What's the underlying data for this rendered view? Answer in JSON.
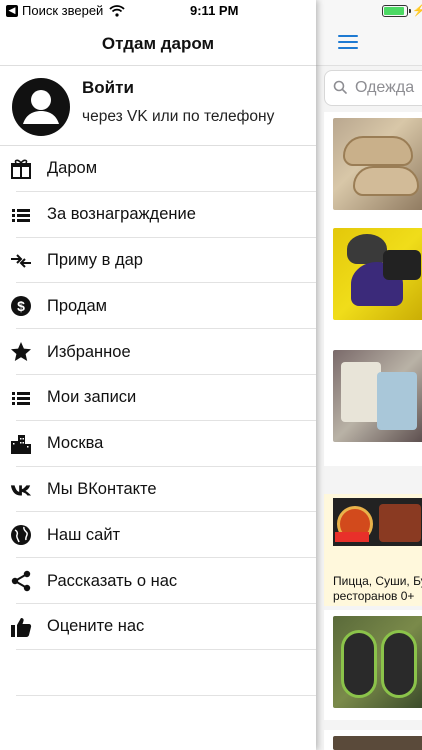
{
  "status_bar": {
    "back_app": "Поиск зверей",
    "time": "9:11 PM",
    "battery_level": 0.9
  },
  "drawer": {
    "title": "Отдам даром",
    "login": {
      "title": "Войти",
      "subtitle": "через VK или по телефону"
    },
    "menu": [
      {
        "label": "Даром",
        "icon": "gift-icon"
      },
      {
        "label": "За вознаграждение",
        "icon": "list-icon"
      },
      {
        "label": "Приму в дар",
        "icon": "swap-arrows-icon"
      },
      {
        "label": "Продам",
        "icon": "dollar-icon"
      },
      {
        "label": "Избранное",
        "icon": "star-icon"
      },
      {
        "label": "Мои записи",
        "icon": "list-icon"
      },
      {
        "label": "Москва",
        "icon": "city-icon"
      },
      {
        "label": "Мы ВКонтакте",
        "icon": "vk-icon"
      },
      {
        "label": "Наш сайт",
        "icon": "globe-icon"
      },
      {
        "label": "Рассказать о нас",
        "icon": "share-icon"
      },
      {
        "label": "Оцените нас",
        "icon": "thumbs-up-icon"
      }
    ]
  },
  "background_page": {
    "search_placeholder": "Одежда",
    "ad": {
      "text_line1": "Пицца, Суши, Бу",
      "text_line2": "ресторанов 0+"
    },
    "colors": {
      "accent": "#1e7ad2",
      "ad_background": "#fff8dc"
    }
  }
}
